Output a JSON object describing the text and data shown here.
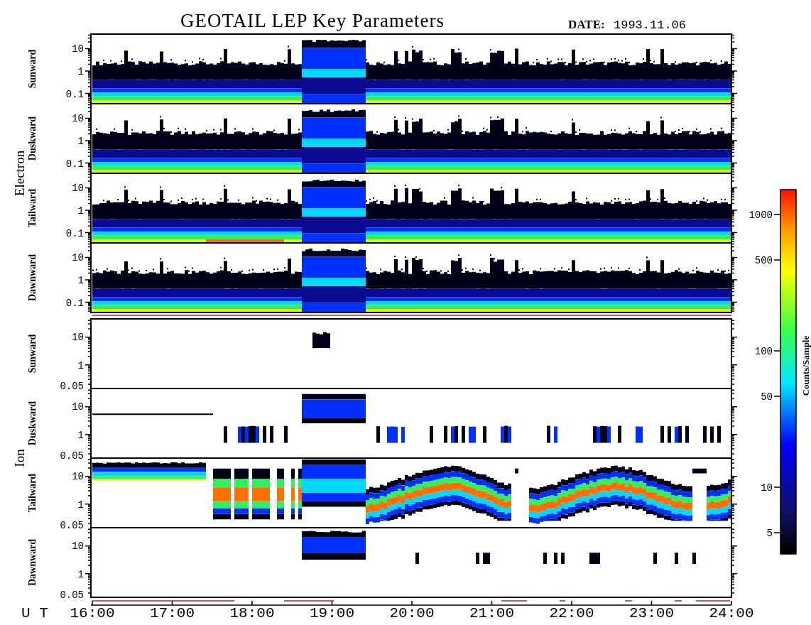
{
  "title": "GEOTAIL LEP Key Parameters",
  "date_label": "DATE:",
  "date": "1993.11.06",
  "sections": [
    {
      "kind": "electron",
      "label": "Electron",
      "panels": [
        {
          "label": "Sunward",
          "yticks": [
            "10",
            "1",
            "0.1"
          ]
        },
        {
          "label": "Duskward",
          "yticks": [
            "10",
            "1",
            "0.1"
          ]
        },
        {
          "label": "Tailward",
          "yticks": [
            "10",
            "1",
            "0.1"
          ]
        },
        {
          "label": "Dawnward",
          "yticks": [
            "10",
            "1",
            "0.1"
          ]
        }
      ]
    },
    {
      "kind": "ion",
      "label": "Ion",
      "panels": [
        {
          "label": "Sunward",
          "yticks": [
            "10",
            "1",
            "0.05"
          ]
        },
        {
          "label": "Duskward",
          "yticks": [
            "10",
            "1",
            "0.05"
          ]
        },
        {
          "label": "Tailward",
          "yticks": [
            "10",
            "1",
            "0.05"
          ]
        },
        {
          "label": "Dawnward",
          "yticks": [
            "10",
            "1",
            "0.05"
          ]
        }
      ]
    }
  ],
  "time_axis": {
    "label": "U T",
    "ticks": [
      "16:00",
      "17:00",
      "18:00",
      "19:00",
      "20:00",
      "21:00",
      "22:00",
      "23:00",
      "24:00"
    ]
  },
  "colorbar": {
    "label": "Counts/Sample",
    "ticks": [
      "1000",
      "500",
      "100",
      "50",
      "10",
      "5"
    ]
  }
}
